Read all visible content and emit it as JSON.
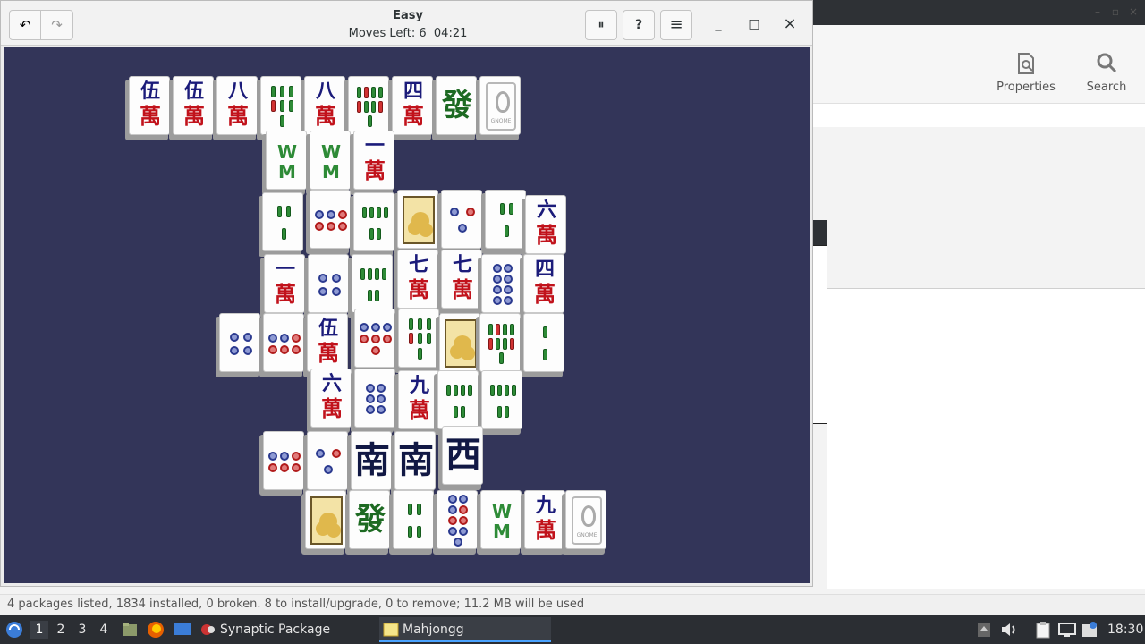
{
  "mahjongg": {
    "title": "Easy",
    "moves_label": "Moves Left:  6",
    "timer": "04:21",
    "undo_icon": "↶",
    "redo_icon": "↷",
    "pause_icon": "⏸",
    "hint_icon": "?",
    "menu_icon": "≡",
    "minimize_icon": "_",
    "maximize_icon": "□",
    "close_icon": "×"
  },
  "synaptic": {
    "properties_label": "Properties",
    "search_label": "Search",
    "status_text": "4 packages listed, 1834 installed, 0 broken. 8 to install/upgrade, 0 to remove; 11.2 MB will be used"
  },
  "taskbar": {
    "desktops": [
      "1",
      "2",
      "3",
      "4"
    ],
    "active_desktop": "1",
    "tasks": [
      {
        "label": "Synaptic Package Man...",
        "icon": "synaptic-icon"
      },
      {
        "label": "Mahjongg",
        "icon": "mahjongg-icon"
      }
    ],
    "clock": "18:30"
  },
  "tiles": {
    "wu": "伍",
    "ba": "八",
    "si": "四",
    "yi": "一",
    "liu": "六",
    "qi": "七",
    "jiu": "九",
    "man": "萬",
    "fa": "發",
    "nan": "南",
    "xi": "西",
    "gnome_text": "GNOME"
  },
  "colors": {
    "board": "#333559",
    "taskbar": "#2b2e33",
    "accent": "#4aa3ff"
  }
}
